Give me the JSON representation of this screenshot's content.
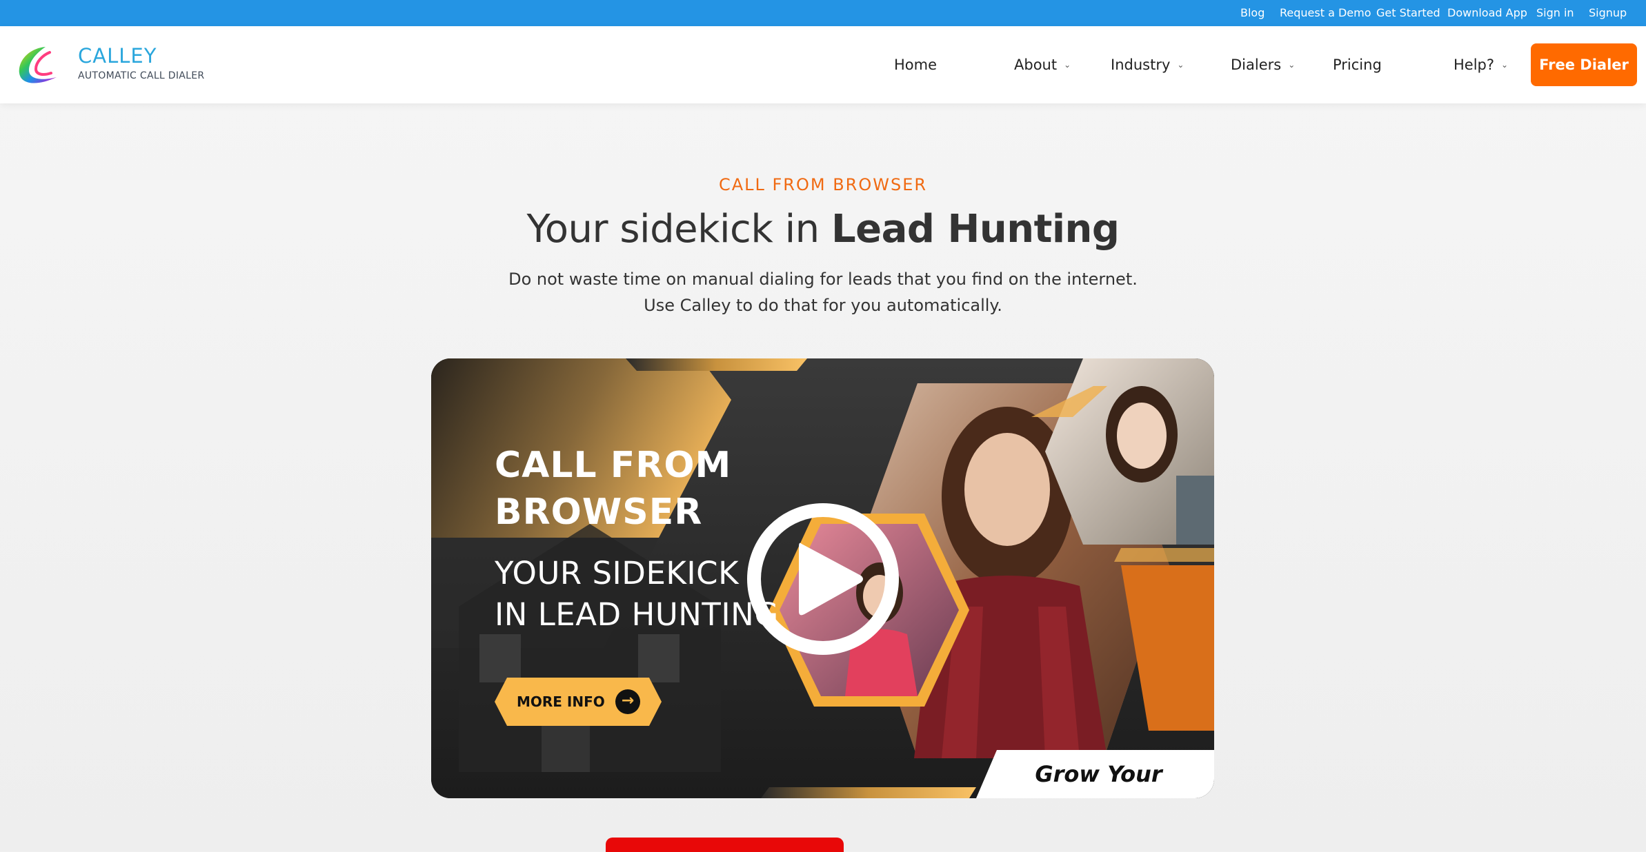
{
  "topbar": {
    "links": [
      "Blog",
      "Request a Demo",
      "Get Started",
      "Download App",
      "Sign in",
      "Signup"
    ]
  },
  "header": {
    "logo_name": "CALLEY",
    "logo_tagline": "AUTOMATIC CALL DIALER",
    "nav": {
      "home": "Home",
      "about": "About",
      "industry": "Industry",
      "dialers": "Dialers",
      "pricing": "Pricing",
      "help": "Help?"
    },
    "chevron_icon": "chevron-down-icon",
    "cta_label": "Free Dialer"
  },
  "hero": {
    "eyebrow": "CALL FROM BROWSER",
    "headline_light": "Your sidekick in ",
    "headline_bold": "Lead Hunting",
    "subtext_line1": "Do not waste time on manual dialing for leads that you find on the internet.",
    "subtext_line2": "Use Calley to do that for you automatically."
  },
  "banner": {
    "title_line1": "CALL FROM",
    "title_line2": "BROWSER",
    "sub_line1": "YOUR SIDEKICK",
    "sub_line2": "IN LEAD HUNTING",
    "more_info": "MORE INFO",
    "tagline": "Grow Your Business?",
    "play_icon": "play-icon",
    "arrow_icon": "arrow-right-icon"
  },
  "colors": {
    "topbar": "#2494e4",
    "accent_orange": "#ff6a00",
    "banner_gold": "#f9b84b",
    "red_block": "#e80808"
  }
}
